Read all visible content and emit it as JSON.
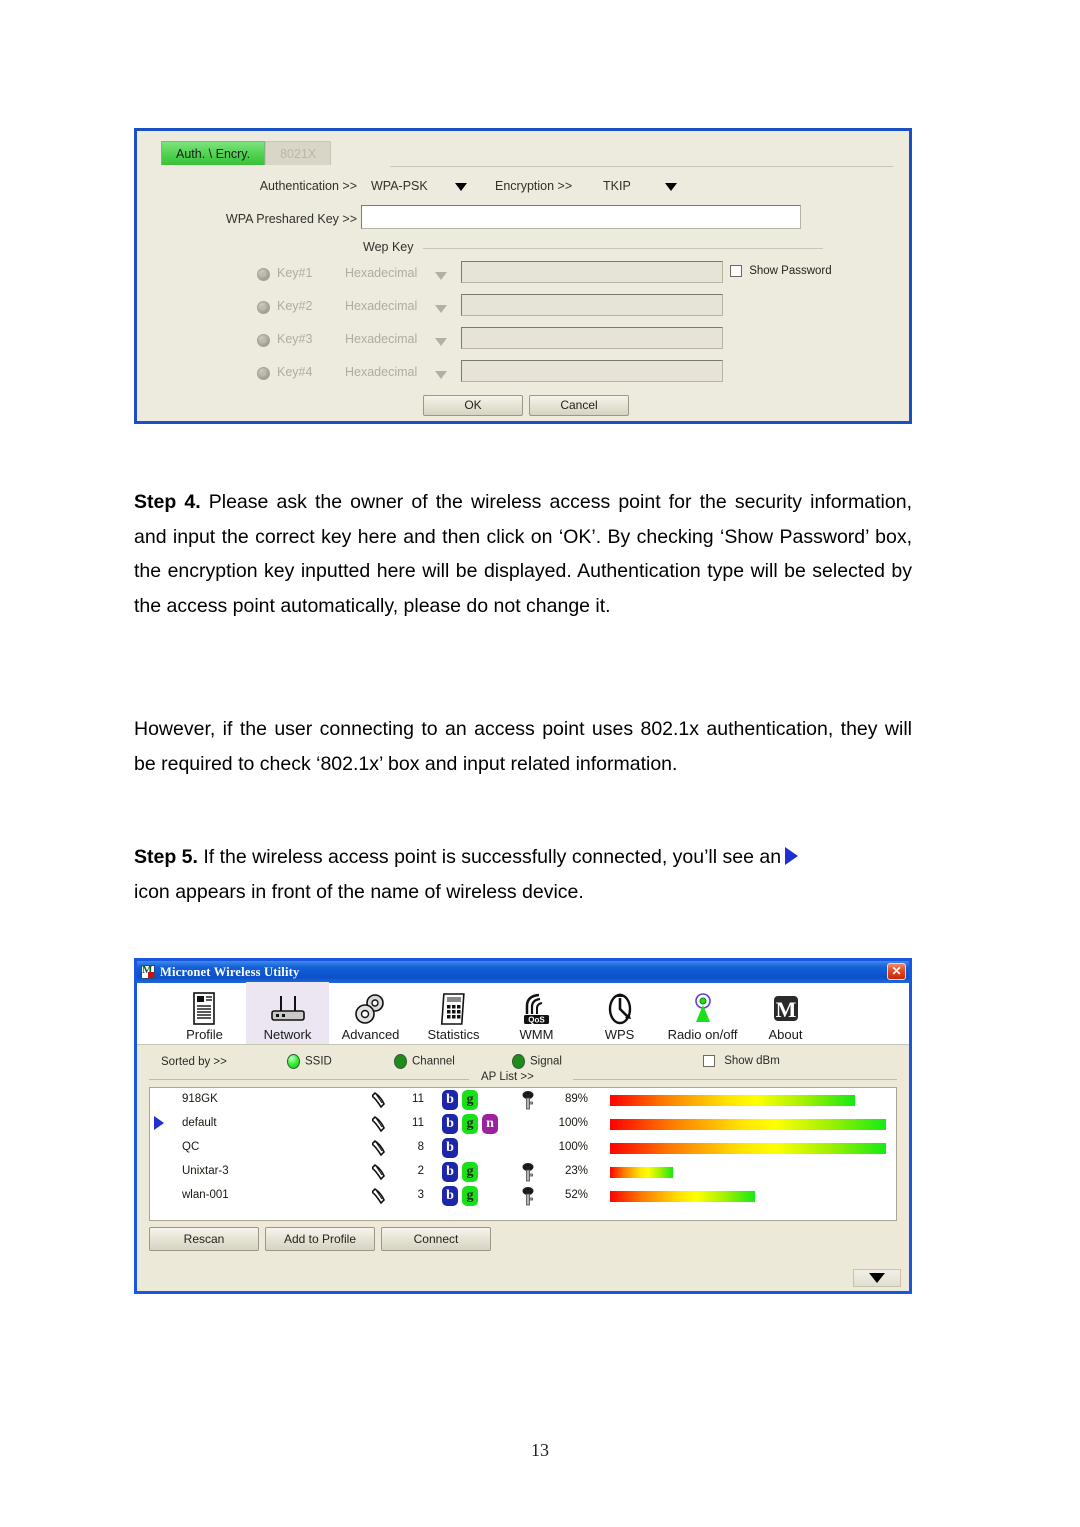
{
  "page": {
    "number": "13"
  },
  "auth_dialog": {
    "tabs": [
      {
        "label": "Auth. \\ Encry.",
        "active": true
      },
      {
        "label": "8021X",
        "active": false
      }
    ],
    "authentication_label": "Authentication >>",
    "authentication_value": "WPA-PSK",
    "encryption_label": "Encryption >>",
    "encryption_value": "TKIP",
    "wpa_preshared_key_label": "WPA Preshared Key >>",
    "wpa_preshared_key_value": "",
    "wep_key_group_label": "Wep Key",
    "show_password_label": "Show Password",
    "show_password_checked": false,
    "wep_keys": [
      {
        "label": "Key#1",
        "format": "Hexadecimal",
        "value": ""
      },
      {
        "label": "Key#2",
        "format": "Hexadecimal",
        "value": ""
      },
      {
        "label": "Key#3",
        "format": "Hexadecimal",
        "value": ""
      },
      {
        "label": "Key#4",
        "format": "Hexadecimal",
        "value": ""
      }
    ],
    "ok_label": "OK",
    "cancel_label": "Cancel"
  },
  "body": {
    "step4_prefix": "Step 4.",
    "step4_text": " Please ask the owner of the wireless access point for the security information, and input the correct key here and then click on ‘OK’. By checking ‘Show Password’ box, the encryption key inputted here will be displayed. Authentication type will be selected by the access point automatically, please do not change it.",
    "however_text": "However, if the user connecting to an access point uses 802.1x authentication, they will be required to check ‘802.1x’ box and input related information.",
    "step5_prefix": "Step 5.",
    "step5_text_a": " If the wireless access point is successfully connected, you’ll see an",
    "step5_text_b": "icon appears in front of the name of wireless device."
  },
  "utility": {
    "title": "Micronet Wireless Utility",
    "close_label": "✕",
    "toolbar": [
      {
        "label": "Profile",
        "icon": "profile-icon",
        "selected": false
      },
      {
        "label": "Network",
        "icon": "network-icon",
        "selected": true
      },
      {
        "label": "Advanced",
        "icon": "advanced-icon",
        "selected": false
      },
      {
        "label": "Statistics",
        "icon": "statistics-icon",
        "selected": false
      },
      {
        "label": "WMM",
        "icon": "wmm-icon",
        "selected": false
      },
      {
        "label": "WPS",
        "icon": "wps-icon",
        "selected": false
      },
      {
        "label": "Radio on/off",
        "icon": "radio-onoff-icon",
        "selected": false
      },
      {
        "label": "About",
        "icon": "about-icon",
        "selected": false
      }
    ],
    "sorted_by_label": "Sorted by >>",
    "sort_options": [
      {
        "label": "SSID",
        "selected": true
      },
      {
        "label": "Channel",
        "selected": false
      },
      {
        "label": "Signal",
        "selected": false
      }
    ],
    "show_dbm_label": "Show dBm",
    "show_dbm_checked": false,
    "ap_list_label": "AP List >>",
    "ap_rows": [
      {
        "connected": false,
        "ssid": "918GK",
        "channel": "11",
        "modes": [
          "b",
          "g"
        ],
        "secured": true,
        "signal_text": "89%",
        "signal_pct": 89
      },
      {
        "connected": true,
        "ssid": "default",
        "channel": "11",
        "modes": [
          "b",
          "g",
          "n"
        ],
        "secured": false,
        "signal_text": "100%",
        "signal_pct": 100
      },
      {
        "connected": false,
        "ssid": "QC",
        "channel": "8",
        "modes": [
          "b"
        ],
        "secured": false,
        "signal_text": "100%",
        "signal_pct": 100
      },
      {
        "connected": false,
        "ssid": "Unixtar-3",
        "channel": "2",
        "modes": [
          "b",
          "g"
        ],
        "secured": true,
        "signal_text": "23%",
        "signal_pct": 23
      },
      {
        "connected": false,
        "ssid": "wlan-001",
        "channel": "3",
        "modes": [
          "b",
          "g"
        ],
        "secured": true,
        "signal_text": "52%",
        "signal_pct": 52
      }
    ],
    "buttons": [
      {
        "label": "Rescan"
      },
      {
        "label": "Add to Profile"
      },
      {
        "label": "Connect"
      }
    ],
    "expander_icon": "chevron-down-icon"
  },
  "colors": {
    "title_blue": "#0b50c8",
    "frame_blue": "#1b56e0",
    "tab_green": "#4fd14f",
    "indicator_blue": "#1f2fd0",
    "mode_b": "#1d25a8",
    "mode_g": "#19e019",
    "mode_n": "#9c219c",
    "dialog_bg": "#edeade"
  }
}
